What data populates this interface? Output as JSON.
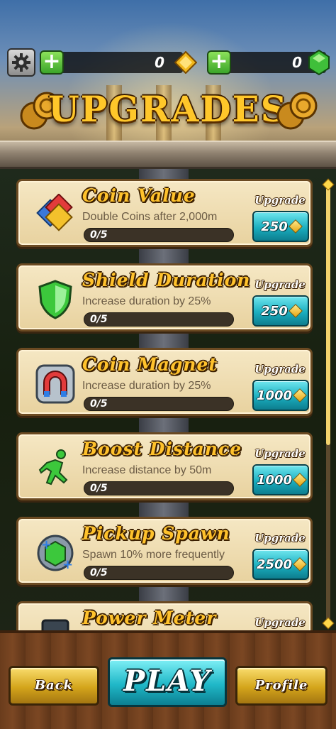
{
  "header": {
    "coins": "0",
    "gems": "0",
    "title": "UPGRADES"
  },
  "upgrades": [
    {
      "name": "Coin Value",
      "description": "Double Coins after 2,000m",
      "progress": "0/5",
      "level": 0,
      "max_level": 5,
      "upgrade_label": "Upgrade",
      "cost": "250",
      "icon": "coin-value-icon"
    },
    {
      "name": "Shield Duration",
      "description": "Increase duration by 25%",
      "progress": "0/5",
      "level": 0,
      "max_level": 5,
      "upgrade_label": "Upgrade",
      "cost": "250",
      "icon": "shield-icon"
    },
    {
      "name": "Coin Magnet",
      "description": "Increase duration by 25%",
      "progress": "0/5",
      "level": 0,
      "max_level": 5,
      "upgrade_label": "Upgrade",
      "cost": "1000",
      "icon": "magnet-icon"
    },
    {
      "name": "Boost Distance",
      "description": "Increase distance by 50m",
      "progress": "0/5",
      "level": 0,
      "max_level": 5,
      "upgrade_label": "Upgrade",
      "cost": "1000",
      "icon": "running-man-icon"
    },
    {
      "name": "Pickup Spawn",
      "description": "Spawn 10% more frequently",
      "progress": "0/5",
      "level": 0,
      "max_level": 5,
      "upgrade_label": "Upgrade",
      "cost": "2500",
      "icon": "pickup-spawn-icon"
    },
    {
      "name": "Power Meter",
      "description": "",
      "progress": "",
      "level": 0,
      "max_level": 5,
      "upgrade_label": "Upgrade",
      "cost": "",
      "icon": "power-meter-icon"
    }
  ],
  "scroll_position": 0.0,
  "footer": {
    "back_label": "Back",
    "play_label": "PLAY",
    "profile_label": "Profile"
  },
  "colors": {
    "title_gold": "#ffc72a",
    "card_bg": "#f5e7c3",
    "button_teal": "#1aaebf",
    "button_gold": "#d4a51b",
    "plus_green": "#3ba52a"
  }
}
